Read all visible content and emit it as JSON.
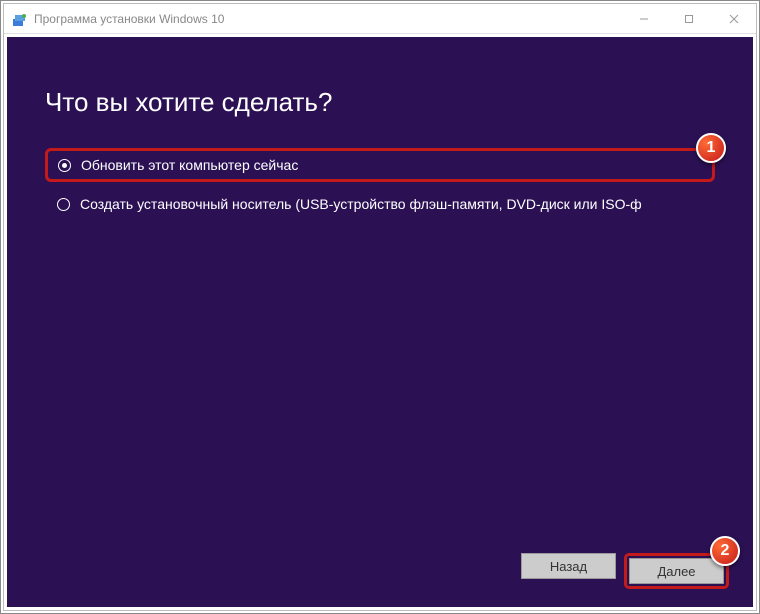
{
  "window": {
    "title": "Программа установки Windows 10"
  },
  "main": {
    "heading": "Что вы хотите сделать?",
    "options": [
      {
        "label": "Обновить этот компьютер сейчас",
        "selected": true
      },
      {
        "label": "Создать установочный носитель (USB-устройство флэш-памяти, DVD-диск или ISO-ф",
        "selected": false
      }
    ]
  },
  "footer": {
    "back": "Назад",
    "next": "Далее"
  },
  "callouts": {
    "one": "1",
    "two": "2"
  }
}
